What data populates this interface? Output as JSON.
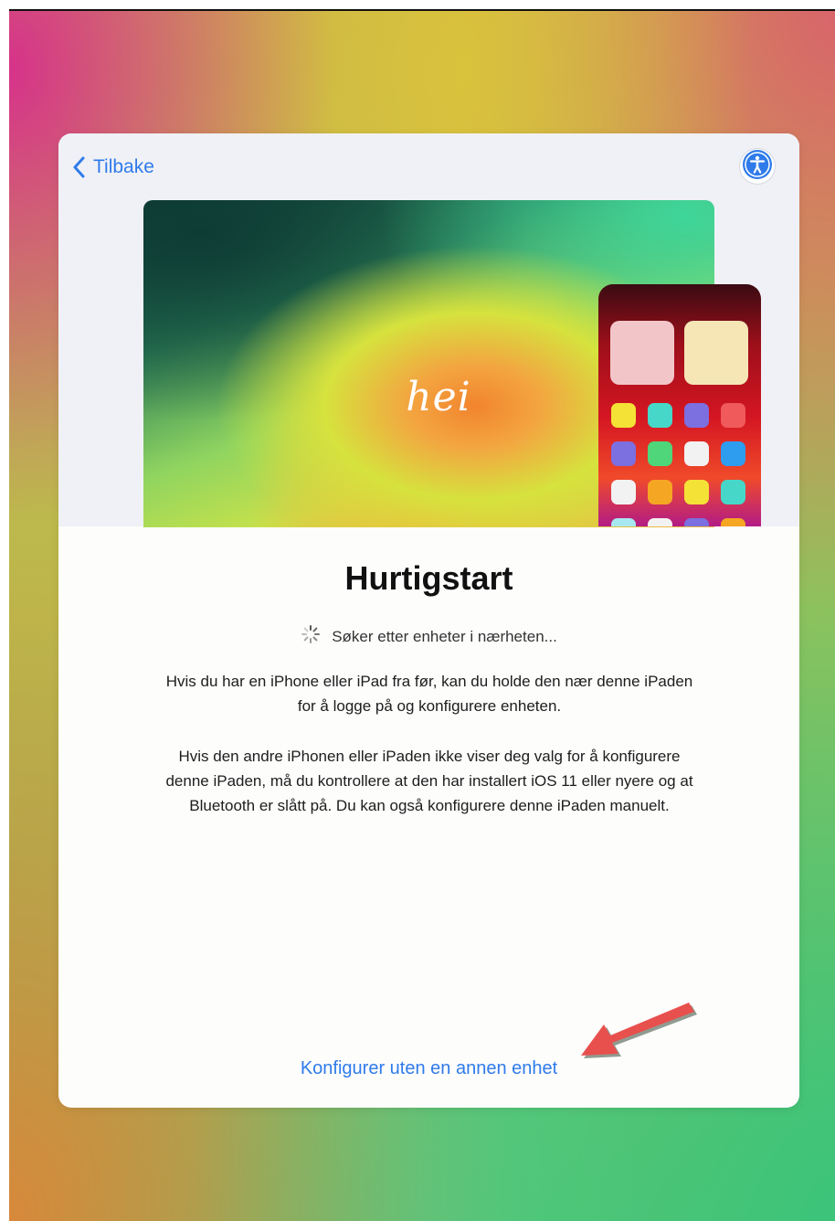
{
  "nav": {
    "back_label": "Tilbake",
    "back_icon": "chevron-left-icon",
    "accessibility_icon": "accessibility-icon"
  },
  "hero": {
    "greeting": "hei"
  },
  "content": {
    "title": "Hurtigstart",
    "status_text": "Søker etter enheter i nærheten...",
    "paragraph_1": "Hvis du har en iPhone eller iPad fra før, kan du holde den nær denne iPaden for å logge på og konfigurere enheten.",
    "paragraph_2": "Hvis den andre iPhonen eller iPaden ikke viser deg valg for å konfigurere denne iPaden, må du kontrollere at den har installert iOS 11 eller nyere og at Bluetooth er slått på. Du kan også konfigurere denne iPaden manuelt."
  },
  "actions": {
    "manual_setup_label": "Konfigurer uten en annen enhet"
  },
  "colors": {
    "accent": "#2f7bea",
    "annotation_arrow": "#e8504d"
  }
}
